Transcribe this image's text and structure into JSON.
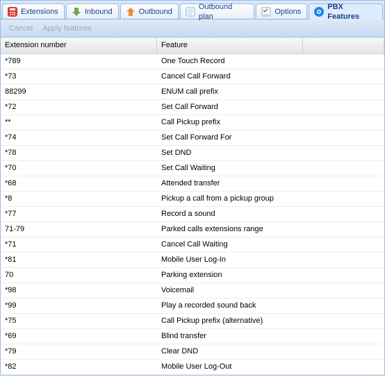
{
  "tabs": [
    {
      "label": "Extensions",
      "icon": "extensions-icon"
    },
    {
      "label": "Inbound",
      "icon": "inbound-icon"
    },
    {
      "label": "Outbound",
      "icon": "outbound-icon"
    },
    {
      "label": "Outbound plan",
      "icon": "outbound-plan-icon"
    },
    {
      "label": "Options",
      "icon": "options-icon"
    },
    {
      "label": "PBX Features",
      "icon": "pbx-features-icon"
    }
  ],
  "toolbar": {
    "cancel": "Cancel",
    "apply": "Apply features"
  },
  "columns": {
    "ext": "Extension number",
    "feat": "Feature"
  },
  "rows": [
    {
      "ext": "*789",
      "feat": "One Touch Record"
    },
    {
      "ext": "*73",
      "feat": "Cancel Call Forward"
    },
    {
      "ext": "88299",
      "feat": "ENUM call prefix"
    },
    {
      "ext": "*72",
      "feat": "Set Call Forward"
    },
    {
      "ext": "**",
      "feat": "Call Pickup prefix"
    },
    {
      "ext": "*74",
      "feat": "Set Call Forward For"
    },
    {
      "ext": "*78",
      "feat": "Set DND"
    },
    {
      "ext": "*70",
      "feat": "Set Call Waiting"
    },
    {
      "ext": "*68",
      "feat": "Attended transfer"
    },
    {
      "ext": "*8",
      "feat": "Pickup a call from a pickup group"
    },
    {
      "ext": "*77",
      "feat": "Record a sound"
    },
    {
      "ext": "71-79",
      "feat": "Parked calls extensions range"
    },
    {
      "ext": "*71",
      "feat": "Cancel Call Waiting"
    },
    {
      "ext": "*81",
      "feat": "Mobile User Log-In"
    },
    {
      "ext": "70",
      "feat": "Parking extension"
    },
    {
      "ext": "*98",
      "feat": "Voicemail"
    },
    {
      "ext": "*99",
      "feat": "Play a recorded sound back"
    },
    {
      "ext": "*75",
      "feat": "Call Pickup prefix (alternative)"
    },
    {
      "ext": "*69",
      "feat": "Blind transfer"
    },
    {
      "ext": "*79",
      "feat": "Clear DND"
    },
    {
      "ext": "*82",
      "feat": "Mobile User Log-Out"
    }
  ]
}
